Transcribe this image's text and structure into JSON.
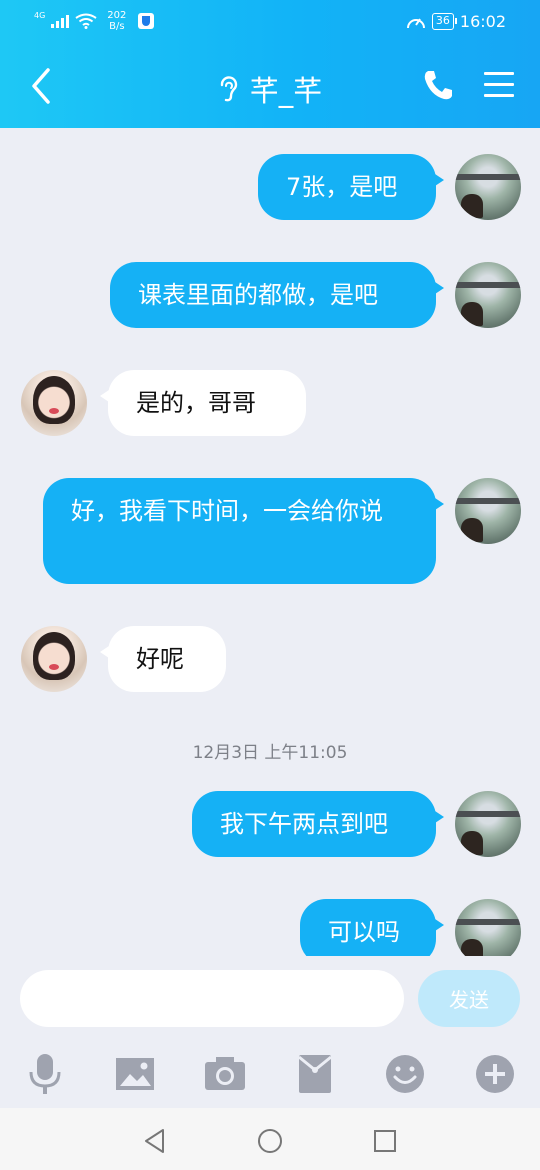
{
  "status_bar": {
    "network_type": "4G",
    "net_speed_value": "202",
    "net_speed_unit": "B/s",
    "battery": "36",
    "time": "16:02"
  },
  "header": {
    "title": "芊_芊",
    "back_icon": "chevron-left-icon",
    "earpiece_icon": "ear-icon",
    "call_icon": "phone-icon",
    "menu_icon": "hamburger-menu-icon"
  },
  "messages": [
    {
      "side": "out",
      "text": "7张，是吧"
    },
    {
      "side": "out",
      "text": "课表里面的都做，是吧"
    },
    {
      "side": "in",
      "text": "是的，哥哥"
    },
    {
      "side": "out",
      "text": "好，我看下时间，一会给你说"
    },
    {
      "side": "in",
      "text": "好呢"
    },
    {
      "side": "out",
      "text": "我下午两点到吧"
    },
    {
      "side": "out",
      "text": "可以吗"
    }
  ],
  "timestamp": "12月3日 上午11:05",
  "composer": {
    "placeholder": "",
    "value": "",
    "send_label": "发送"
  },
  "toolbar": [
    "mic-icon",
    "image-icon",
    "camera-icon",
    "red-packet-icon",
    "emoji-icon",
    "plus-icon"
  ],
  "colors": {
    "accent": "#15b1f5",
    "header_gradient_start": "#1ec8f5",
    "header_gradient_end": "#17a6f4",
    "chat_bg": "#eceef5",
    "send_disabled": "#bfe9fb",
    "toolbar_icon": "#9fa3af"
  },
  "nav": [
    "back-triangle-icon",
    "home-circle-icon",
    "recents-square-icon"
  ]
}
